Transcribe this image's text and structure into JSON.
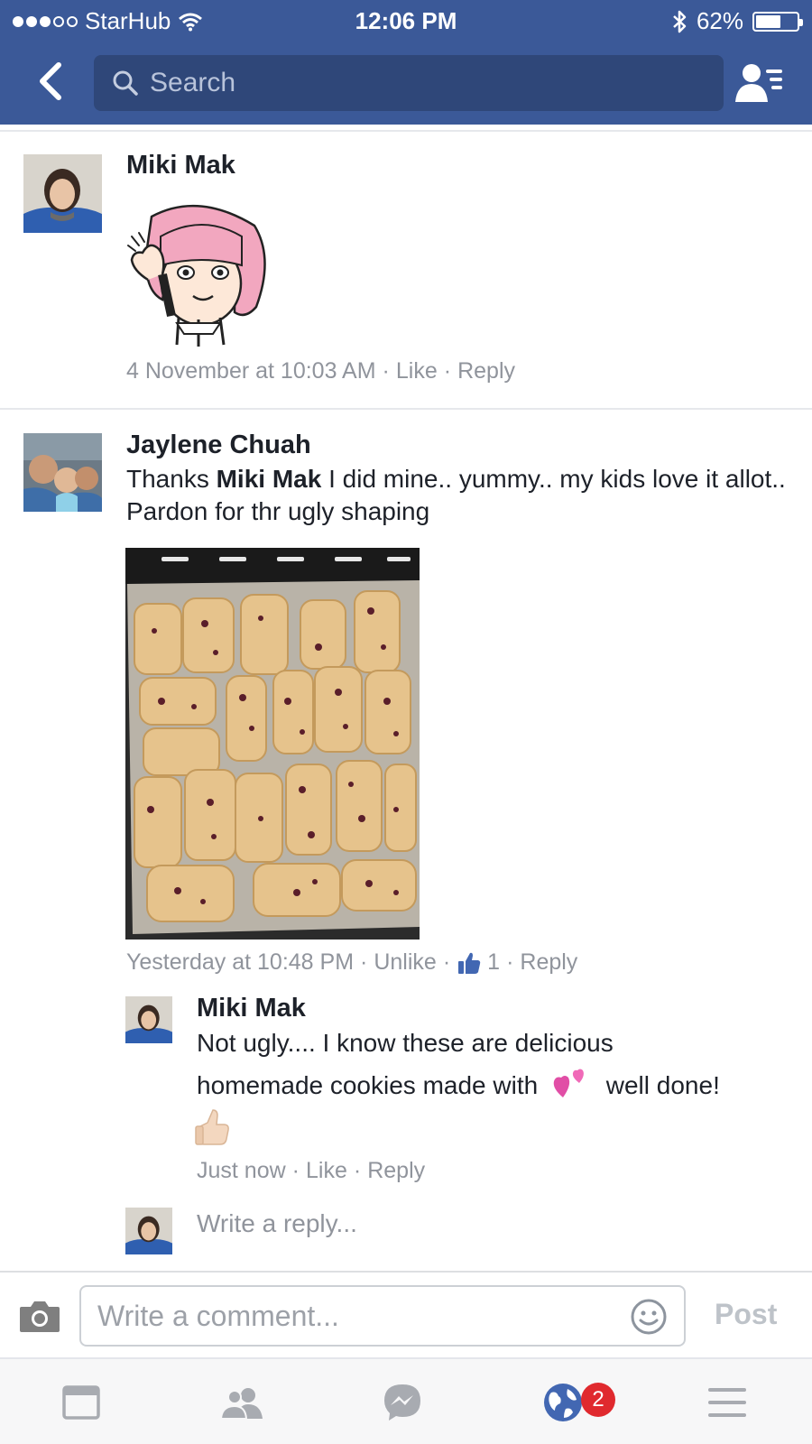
{
  "status_bar": {
    "carrier": "StarHub",
    "time": "12:06 PM",
    "battery_percent": "62%",
    "battery_level": 0.62
  },
  "header": {
    "search_placeholder": "Search",
    "icons": {
      "back": "chevron-left-icon",
      "search": "search-icon",
      "friends": "friends-list-icon"
    }
  },
  "comments": [
    {
      "author": "Miki Mak",
      "sticker": "waving-girl-sticker",
      "timestamp": "4 November at 10:03 AM",
      "like_label": "Like",
      "reply_label": "Reply"
    },
    {
      "author": "Jaylene Chuah",
      "text_prefix": "Thanks",
      "mention": "Miki Mak",
      "text_suffix": "I did mine.. yummy.. my kids love it allot.. Pardon for thr ugly shaping",
      "photo": "tray-of-cranberry-cookies",
      "timestamp": "Yesterday at 10:48 PM",
      "like_label": "Unlike",
      "like_count": "1",
      "reply_label": "Reply",
      "replies": [
        {
          "author": "Miki Mak",
          "text_line1": "Not ugly.... I know these are delicious",
          "text_line2a": "homemade cookies made with",
          "text_line2b": "well done!",
          "timestamp": "Just now",
          "like_label": "Like",
          "reply_label": "Reply"
        }
      ],
      "reply_placeholder": "Write a reply..."
    }
  ],
  "composer": {
    "placeholder": "Write a comment...",
    "post_label": "Post"
  },
  "tabbar": {
    "items": [
      "news-feed-icon",
      "friends-icon",
      "messenger-icon",
      "notifications-globe-icon",
      "menu-icon"
    ],
    "notification_badge": "2"
  },
  "colors": {
    "header_blue": "#3b5998",
    "search_bg": "#2f4779",
    "link_blue": "#4267b2",
    "meta_gray": "#90949c",
    "badge_red": "#e0292e"
  }
}
